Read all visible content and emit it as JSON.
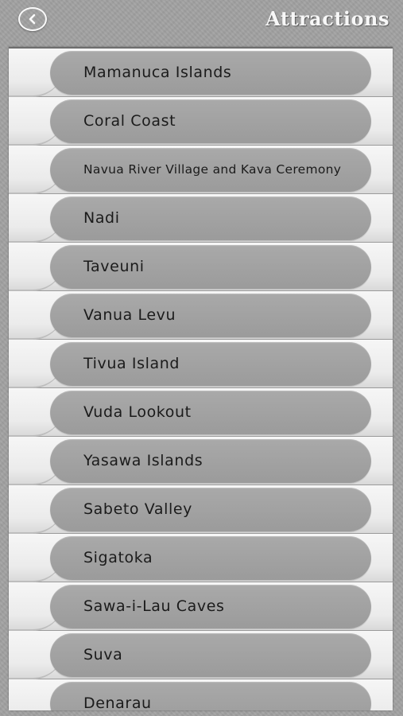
{
  "header": {
    "title": "Attractions",
    "back_icon": "chevron-left-circle-icon"
  },
  "attractions": [
    "Mamanuca Islands",
    "Coral Coast",
    "Navua River Village and Kava Ceremony",
    "Nadi",
    "Taveuni",
    "Vanua Levu",
    "Tivua Island",
    "Vuda Lookout",
    "Yasawa Islands",
    "Sabeto Valley",
    "Sigatoka",
    "Sawa-i-Lau Caves",
    "Suva",
    "Denarau"
  ]
}
